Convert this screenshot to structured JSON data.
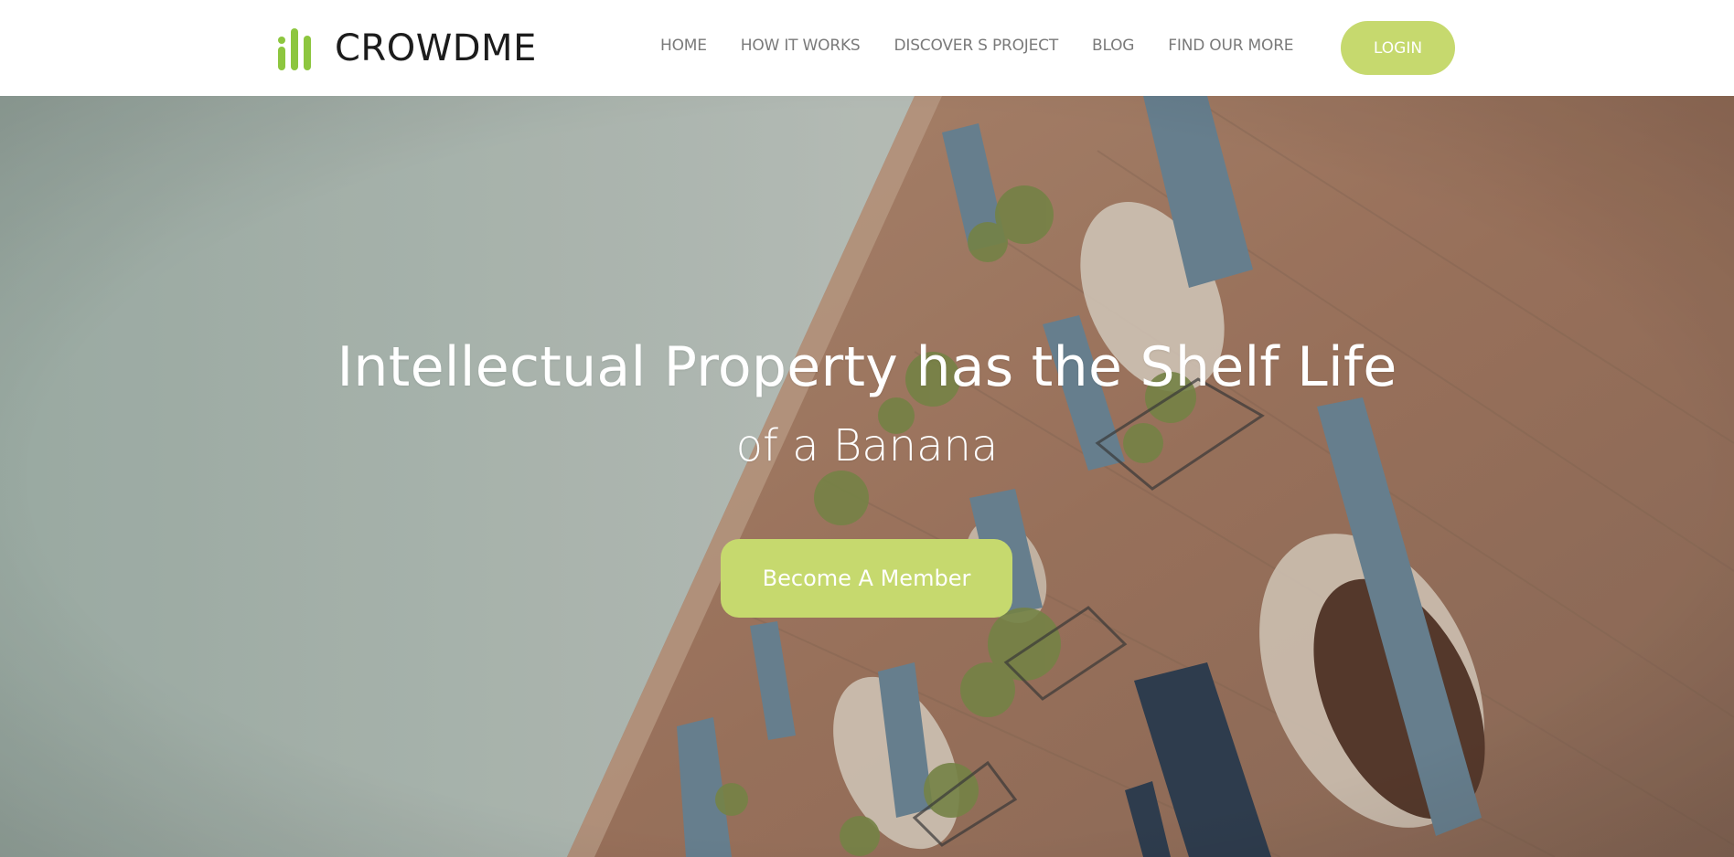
{
  "brand": {
    "name": "CROWDME",
    "logo_icon": "bars-logo-icon",
    "accent_color": "#8dc63f"
  },
  "nav": {
    "items": [
      {
        "label": "HOME"
      },
      {
        "label": "HOW IT WORKS"
      },
      {
        "label": "DISCOVER S PROJECT"
      },
      {
        "label": "BLOG"
      },
      {
        "label": "FIND OUR MORE"
      }
    ],
    "login_label": "LOGIN"
  },
  "hero": {
    "title": "Intellectual Property has the Shelf Life",
    "subtitle": "of a Banana",
    "cta_label": "Become A Member",
    "cta_color": "#c6d96e",
    "background_icon": "building-facade-photo"
  }
}
